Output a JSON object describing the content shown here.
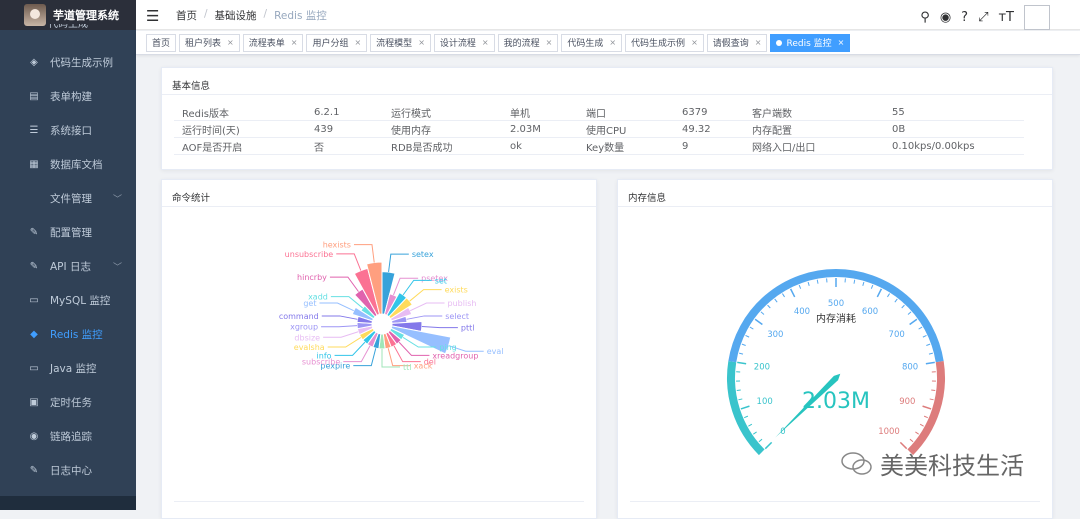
{
  "app": {
    "title": "芋道管理系统",
    "cut_text": "代码生成"
  },
  "sidebar": {
    "items": [
      {
        "label": "代码生成示例",
        "icon": "shield-icon",
        "glyph": "◈"
      },
      {
        "label": "表单构建",
        "icon": "form-icon",
        "glyph": "▤"
      },
      {
        "label": "系统接口",
        "icon": "sliders-icon",
        "glyph": "☰"
      },
      {
        "label": "数据库文档",
        "icon": "table-icon",
        "glyph": "▦"
      },
      {
        "label": "文件管理",
        "icon": "",
        "glyph": "",
        "arrow": "﹀"
      },
      {
        "label": "配置管理",
        "icon": "edit-icon",
        "glyph": "✎"
      },
      {
        "label": "API 日志",
        "icon": "log-icon",
        "glyph": "✎",
        "arrow": "﹀"
      },
      {
        "label": "MySQL 监控",
        "icon": "monitor-icon",
        "glyph": "▭"
      },
      {
        "label": "Redis 监控",
        "icon": "layers-icon",
        "glyph": "◆",
        "active": true
      },
      {
        "label": "Java 监控",
        "icon": "monitor-icon",
        "glyph": "▭"
      },
      {
        "label": "定时任务",
        "icon": "clock-icon",
        "glyph": "▣"
      },
      {
        "label": "链路追踪",
        "icon": "eye-icon",
        "glyph": "◉"
      },
      {
        "label": "日志中心",
        "icon": "log-icon",
        "glyph": "✎"
      }
    ]
  },
  "breadcrumb": {
    "items": [
      "首页",
      "基础设施",
      "Redis 监控"
    ],
    "sep": "/"
  },
  "header": {
    "icons": {
      "search": "⚲",
      "github": "◉",
      "help": "?",
      "fullscreen": "⤢",
      "size": "ᴛT"
    },
    "caret": "▾"
  },
  "tags": [
    {
      "label": "首页",
      "closable": false
    },
    {
      "label": "租户列表",
      "closable": true
    },
    {
      "label": "流程表单",
      "closable": true
    },
    {
      "label": "用户分组",
      "closable": true
    },
    {
      "label": "流程模型",
      "closable": true
    },
    {
      "label": "设计流程",
      "closable": true
    },
    {
      "label": "我的流程",
      "closable": true
    },
    {
      "label": "代码生成",
      "closable": true
    },
    {
      "label": "代码生成示例",
      "closable": true
    },
    {
      "label": "请假查询",
      "closable": true
    },
    {
      "label": "Redis 监控",
      "closable": true,
      "active": true
    }
  ],
  "tag_close": "×",
  "basic": {
    "title": "基本信息",
    "rows": [
      [
        "Redis版本",
        "6.2.1",
        "运行模式",
        "单机",
        "端口",
        "6379",
        "客户端数",
        "55"
      ],
      [
        "运行时间(天)",
        "439",
        "使用内存",
        "2.03M",
        "使用CPU",
        "49.32",
        "内存配置",
        "0B"
      ],
      [
        "AOF是否开启",
        "否",
        "RDB是否成功",
        "ok",
        "Key数量",
        "9",
        "网络入口/出口",
        "0.10kps/0.00kps"
      ]
    ]
  },
  "commands": {
    "title": "命令统计"
  },
  "memory": {
    "title": "内存信息"
  },
  "chart_data": [
    {
      "type": "nightingale-rose",
      "title": "命令统计",
      "categories": [
        "setex",
        "psetex",
        "set",
        "exists",
        "publish",
        "select",
        "pttl",
        "eval",
        "ping",
        "xreadgroup",
        "del",
        "xack",
        "ttl",
        "pexpire",
        "subscribe",
        "info",
        "evalsha",
        "dbsize",
        "xgroup",
        "command",
        "get",
        "xadd",
        "hincrby",
        "unsubscribe",
        "hexists"
      ],
      "values": [
        8,
        2,
        3,
        3,
        2,
        1,
        4,
        16,
        1,
        1,
        1,
        1,
        1,
        1,
        1,
        1,
        1,
        1,
        1,
        1,
        2,
        1,
        4,
        10,
        12
      ],
      "colors": [
        "#37a2da",
        "#e690d1",
        "#32c5e9",
        "#ffdb5c",
        "#e7bcf3",
        "#9d96f5",
        "#8378ea",
        "#96bfff",
        "#67e0e3",
        "#e062ae",
        "#fb7293",
        "#ff9f7f",
        "#9fe6b8"
      ]
    },
    {
      "type": "gauge",
      "title": "内存消耗",
      "value": 2.03,
      "display": "2.03M",
      "min": 0,
      "max": 1000,
      "split": 10,
      "ticks": [
        "0",
        "100",
        "200",
        "300",
        "400",
        "500",
        "600",
        "700",
        "800",
        "900",
        "1000"
      ],
      "bands": [
        {
          "to": 0.2,
          "color": "#3ac4cc"
        },
        {
          "to": 0.8,
          "color": "#55a8ef"
        },
        {
          "to": 1,
          "color": "#dd7c7c"
        }
      ]
    }
  ],
  "watermark": {
    "text": "美美科技生活"
  }
}
